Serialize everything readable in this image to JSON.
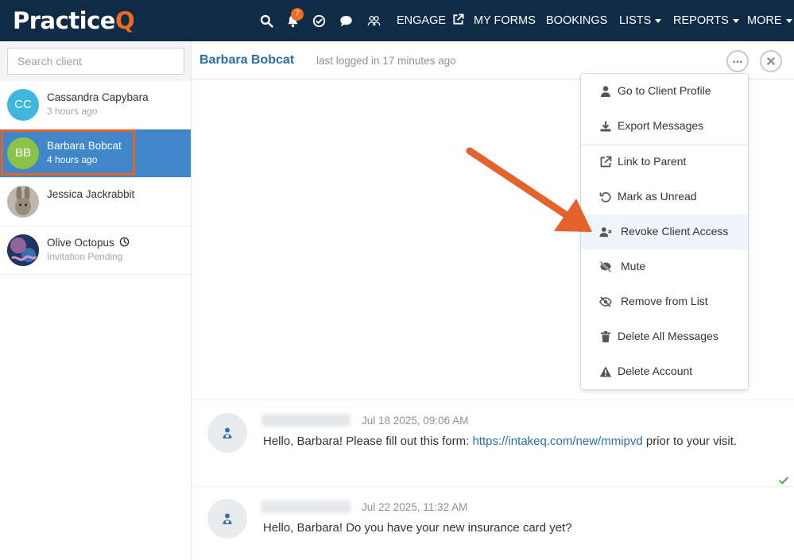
{
  "app": {
    "logo_main": "Practice",
    "logo_accent": "Q",
    "accent_color": "#f26a21",
    "nav_bg": "#0f2b46"
  },
  "nav": {
    "icons": [
      "search-icon",
      "bell-icon",
      "check-circle-icon",
      "chat-bubble-icon",
      "people-group-icon"
    ],
    "notification_count": "7",
    "links": [
      {
        "label": "ENGAGE",
        "icon": "external-link-icon"
      },
      {
        "label": "MY FORMS"
      },
      {
        "label": "BOOKINGS"
      },
      {
        "label": "LISTS",
        "dropdown": true
      },
      {
        "label": "REPORTS",
        "dropdown": true
      },
      {
        "label": "MORE",
        "dropdown": true
      }
    ]
  },
  "sidebar": {
    "search_placeholder": "Search client",
    "clients": [
      {
        "initials": "CC",
        "name": "Cassandra Capybara",
        "sub": "3 hours ago",
        "avatar_color": "#3fb6dd"
      },
      {
        "initials": "BB",
        "name": "Barbara Bobcat",
        "sub": "4 hours ago",
        "avatar_color": "#8bc34a",
        "active": true
      },
      {
        "initials": "",
        "name": "Jessica Jackrabbit",
        "sub": "",
        "avatar": "rabbit-photo"
      },
      {
        "initials": "",
        "name": "Olive Octopus",
        "sub": "Invitation Pending",
        "avatar": "octopus-photo",
        "status_icon": "clock-icon"
      }
    ]
  },
  "conversation": {
    "client_name": "Barbara Bobcat",
    "status": "last logged in 17 minutes ago",
    "header_buttons": [
      "more-options-icon",
      "close-icon"
    ]
  },
  "menu": {
    "items": [
      {
        "label": "Go to Client Profile",
        "icon": "user-icon"
      },
      {
        "label": "Export Messages",
        "icon": "download-icon"
      },
      {
        "label": "Link to Parent",
        "icon": "external-link-icon"
      },
      {
        "label": "Mark as Unread",
        "icon": "undo-icon"
      },
      {
        "label": "Revoke Client Access",
        "icon": "user-remove-icon",
        "highlighted": true
      },
      {
        "label": "Mute",
        "icon": "mute-bubble-icon"
      },
      {
        "label": "Remove from List",
        "icon": "eye-slash-icon"
      },
      {
        "label": "Delete All Messages",
        "icon": "trash-icon"
      },
      {
        "label": "Delete Account",
        "icon": "warning-icon"
      }
    ]
  },
  "messages": [
    {
      "time": "Jul 18 2025, 09:06 AM",
      "text_before": "Hello, Barbara! Please fill out this form: ",
      "link": "https://intakeq.com/new/mmipvd",
      "text_after": " prior to your visit.",
      "read": true
    },
    {
      "time": "Jul 22 2025, 11:32 AM",
      "text_before": "Hello, Barbara! Do you have your new insurance card yet?",
      "link": "",
      "text_after": ""
    }
  ]
}
